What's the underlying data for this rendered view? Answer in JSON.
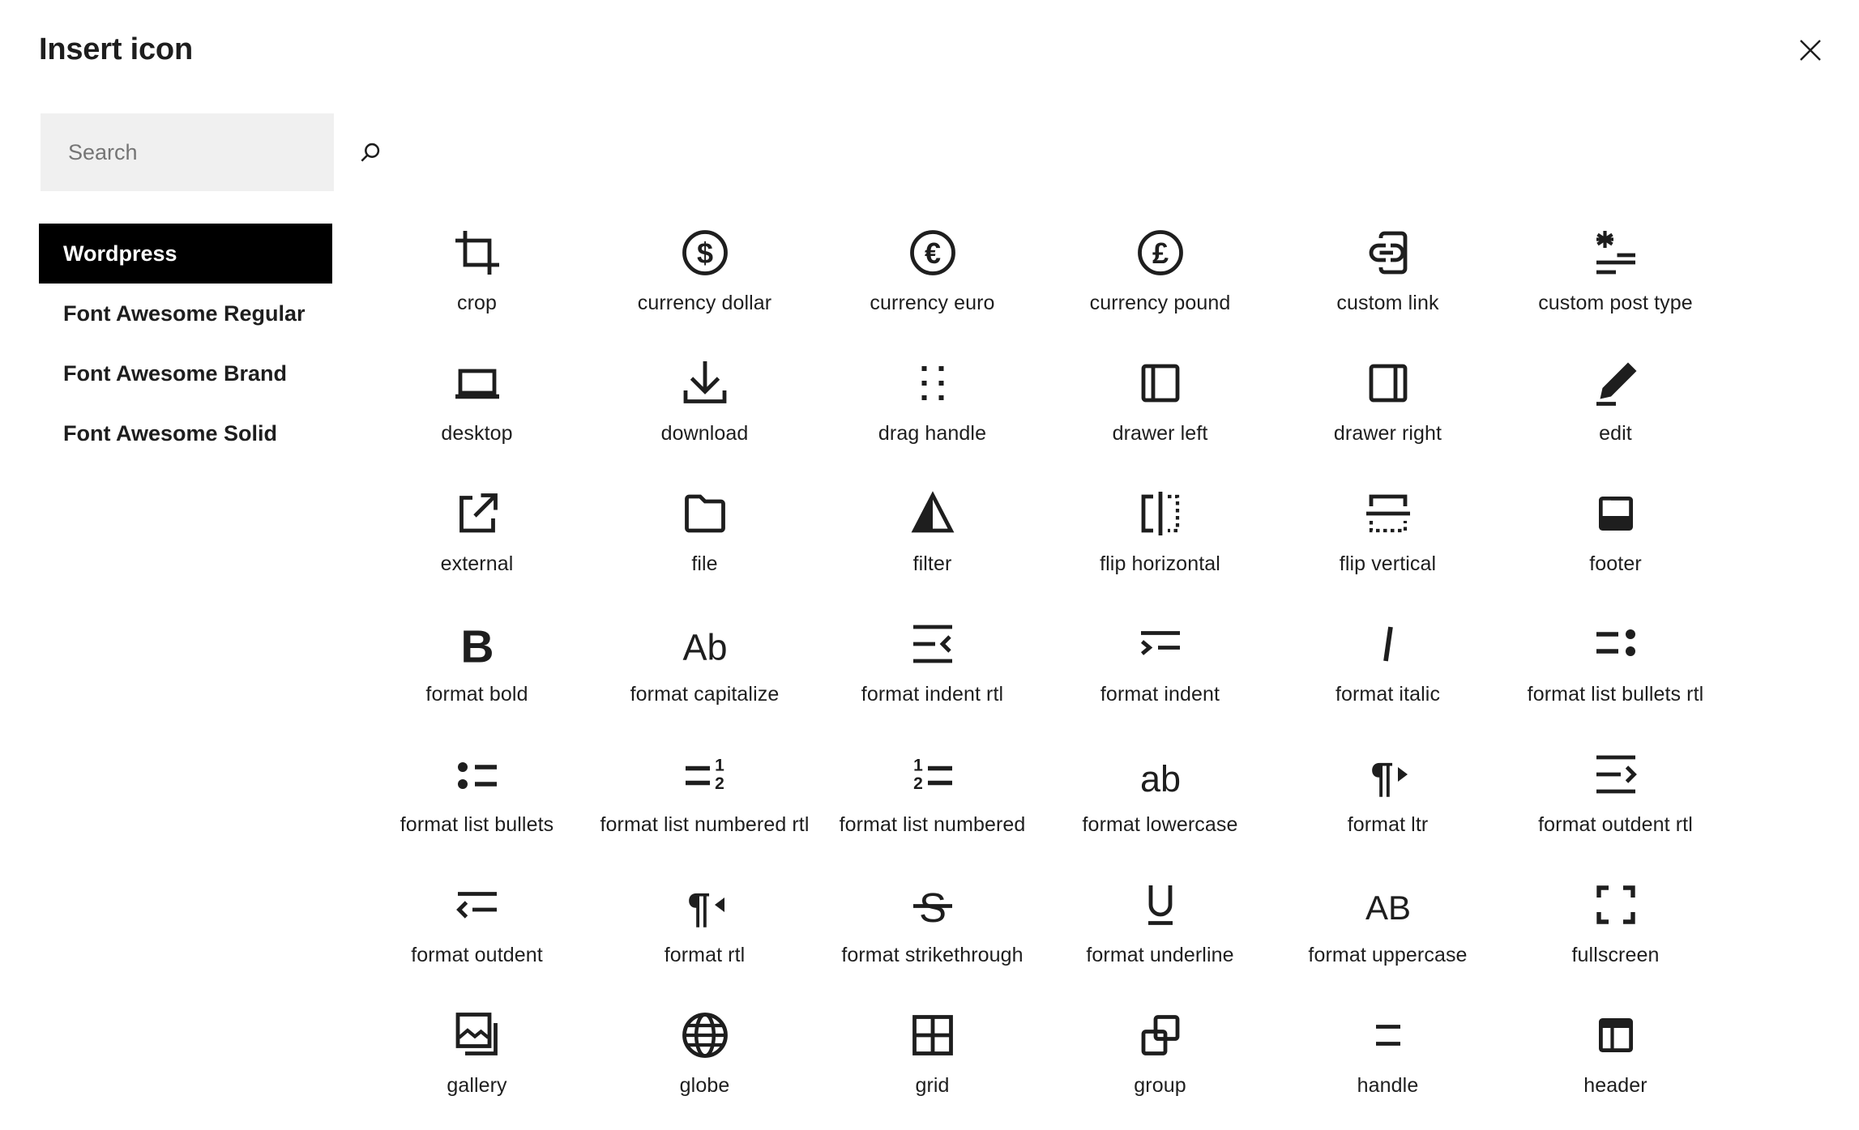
{
  "dialog": {
    "title": "Insert icon",
    "close_icon": "close-icon"
  },
  "search": {
    "placeholder": "Search",
    "value": "",
    "icon": "search-icon"
  },
  "sidebar": {
    "items": [
      {
        "label": "Wordpress",
        "active": true
      },
      {
        "label": "Font Awesome Regular",
        "active": false
      },
      {
        "label": "Font Awesome Brand",
        "active": false
      },
      {
        "label": "Font Awesome Solid",
        "active": false
      }
    ]
  },
  "icons": [
    {
      "label": "crop",
      "icon": "crop-icon"
    },
    {
      "label": "currency dollar",
      "icon": "currency-dollar-icon"
    },
    {
      "label": "currency euro",
      "icon": "currency-euro-icon"
    },
    {
      "label": "currency pound",
      "icon": "currency-pound-icon"
    },
    {
      "label": "custom link",
      "icon": "custom-link-icon"
    },
    {
      "label": "custom post type",
      "icon": "custom-post-type-icon"
    },
    {
      "label": "desktop",
      "icon": "desktop-icon"
    },
    {
      "label": "download",
      "icon": "download-icon"
    },
    {
      "label": "drag handle",
      "icon": "drag-handle-icon"
    },
    {
      "label": "drawer left",
      "icon": "drawer-left-icon"
    },
    {
      "label": "drawer right",
      "icon": "drawer-right-icon"
    },
    {
      "label": "edit",
      "icon": "edit-icon"
    },
    {
      "label": "external",
      "icon": "external-icon"
    },
    {
      "label": "file",
      "icon": "file-icon"
    },
    {
      "label": "filter",
      "icon": "filter-icon"
    },
    {
      "label": "flip horizontal",
      "icon": "flip-horizontal-icon"
    },
    {
      "label": "flip vertical",
      "icon": "flip-vertical-icon"
    },
    {
      "label": "footer",
      "icon": "footer-icon"
    },
    {
      "label": "format bold",
      "icon": "format-bold-icon"
    },
    {
      "label": "format capitalize",
      "icon": "format-capitalize-icon"
    },
    {
      "label": "format indent rtl",
      "icon": "format-indent-rtl-icon"
    },
    {
      "label": "format indent",
      "icon": "format-indent-icon"
    },
    {
      "label": "format italic",
      "icon": "format-italic-icon"
    },
    {
      "label": "format list bullets rtl",
      "icon": "format-list-bullets-rtl-icon"
    },
    {
      "label": "format list bullets",
      "icon": "format-list-bullets-icon"
    },
    {
      "label": "format list numbered rtl",
      "icon": "format-list-numbered-rtl-icon"
    },
    {
      "label": "format list numbered",
      "icon": "format-list-numbered-icon"
    },
    {
      "label": "format lowercase",
      "icon": "format-lowercase-icon"
    },
    {
      "label": "format ltr",
      "icon": "format-ltr-icon"
    },
    {
      "label": "format outdent rtl",
      "icon": "format-outdent-rtl-icon"
    },
    {
      "label": "format outdent",
      "icon": "format-outdent-icon"
    },
    {
      "label": "format rtl",
      "icon": "format-rtl-icon"
    },
    {
      "label": "format strikethrough",
      "icon": "format-strikethrough-icon"
    },
    {
      "label": "format underline",
      "icon": "format-underline-icon"
    },
    {
      "label": "format uppercase",
      "icon": "format-uppercase-icon"
    },
    {
      "label": "fullscreen",
      "icon": "fullscreen-icon"
    },
    {
      "label": "gallery",
      "icon": "gallery-icon"
    },
    {
      "label": "globe",
      "icon": "globe-icon"
    },
    {
      "label": "grid",
      "icon": "grid-icon"
    },
    {
      "label": "group",
      "icon": "group-icon"
    },
    {
      "label": "handle",
      "icon": "handle-icon"
    },
    {
      "label": "header",
      "icon": "header-icon"
    }
  ],
  "colors": {
    "text": "#1e1e1e",
    "active_bg": "#000000",
    "active_text": "#ffffff",
    "search_bg": "#f0f0f0",
    "placeholder": "#757575"
  }
}
